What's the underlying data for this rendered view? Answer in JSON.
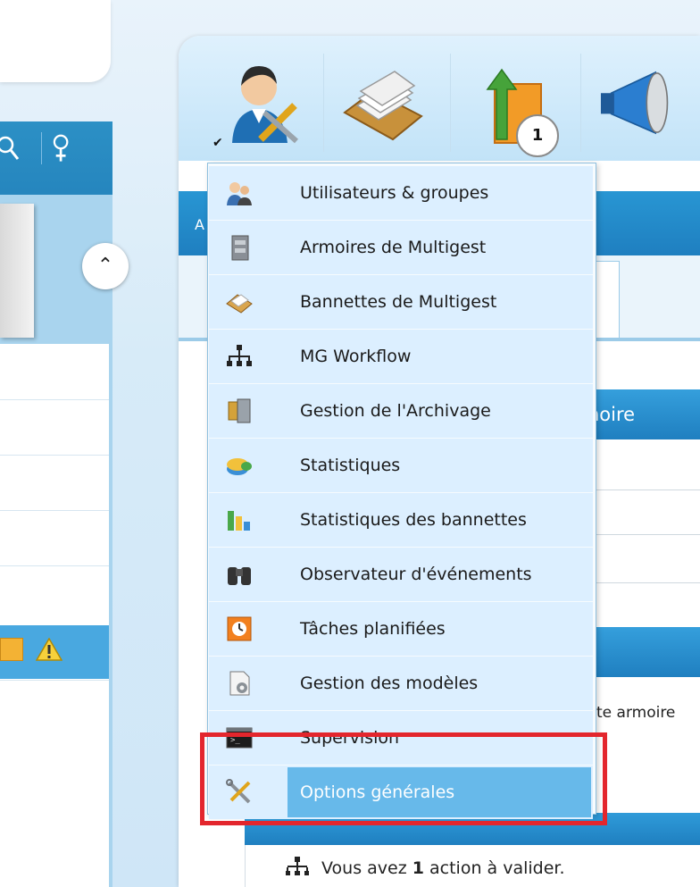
{
  "notification_count": "1",
  "menu_items": [
    {
      "label": "Utilisateurs & groupes",
      "icon": "users-icon"
    },
    {
      "label": "Armoires de Multigest",
      "icon": "cabinet-icon"
    },
    {
      "label": "Bannettes de Multigest",
      "icon": "tray-icon"
    },
    {
      "label": "MG Workflow",
      "icon": "workflow-icon"
    },
    {
      "label": "Gestion de l'Archivage",
      "icon": "archive-icon"
    },
    {
      "label": "Statistiques",
      "icon": "statistics-icon"
    },
    {
      "label": "Statistiques des bannettes",
      "icon": "bar-chart-icon"
    },
    {
      "label": "Observateur d'événements",
      "icon": "binoculars-icon"
    },
    {
      "label": "Tâches planifiées",
      "icon": "scheduled-tasks-icon"
    },
    {
      "label": "Gestion des modèles",
      "icon": "templates-icon"
    },
    {
      "label": "Supervision",
      "icon": "console-icon"
    },
    {
      "label": "Options générales",
      "icon": "tools-icon"
    }
  ],
  "selected_item": "Options générales",
  "right_panel": {
    "header_partial": "noire",
    "armoire_text": "te armoire",
    "footer_text_prefix": "Vous avez",
    "footer_count": "1",
    "footer_text_suffix": "action à valider."
  },
  "tab_label_partial": "A",
  "colors": {
    "accent": "#1f7fc0",
    "highlight": "#67b9ea",
    "menu_bg": "#dcefff",
    "callout": "#e3262d"
  }
}
